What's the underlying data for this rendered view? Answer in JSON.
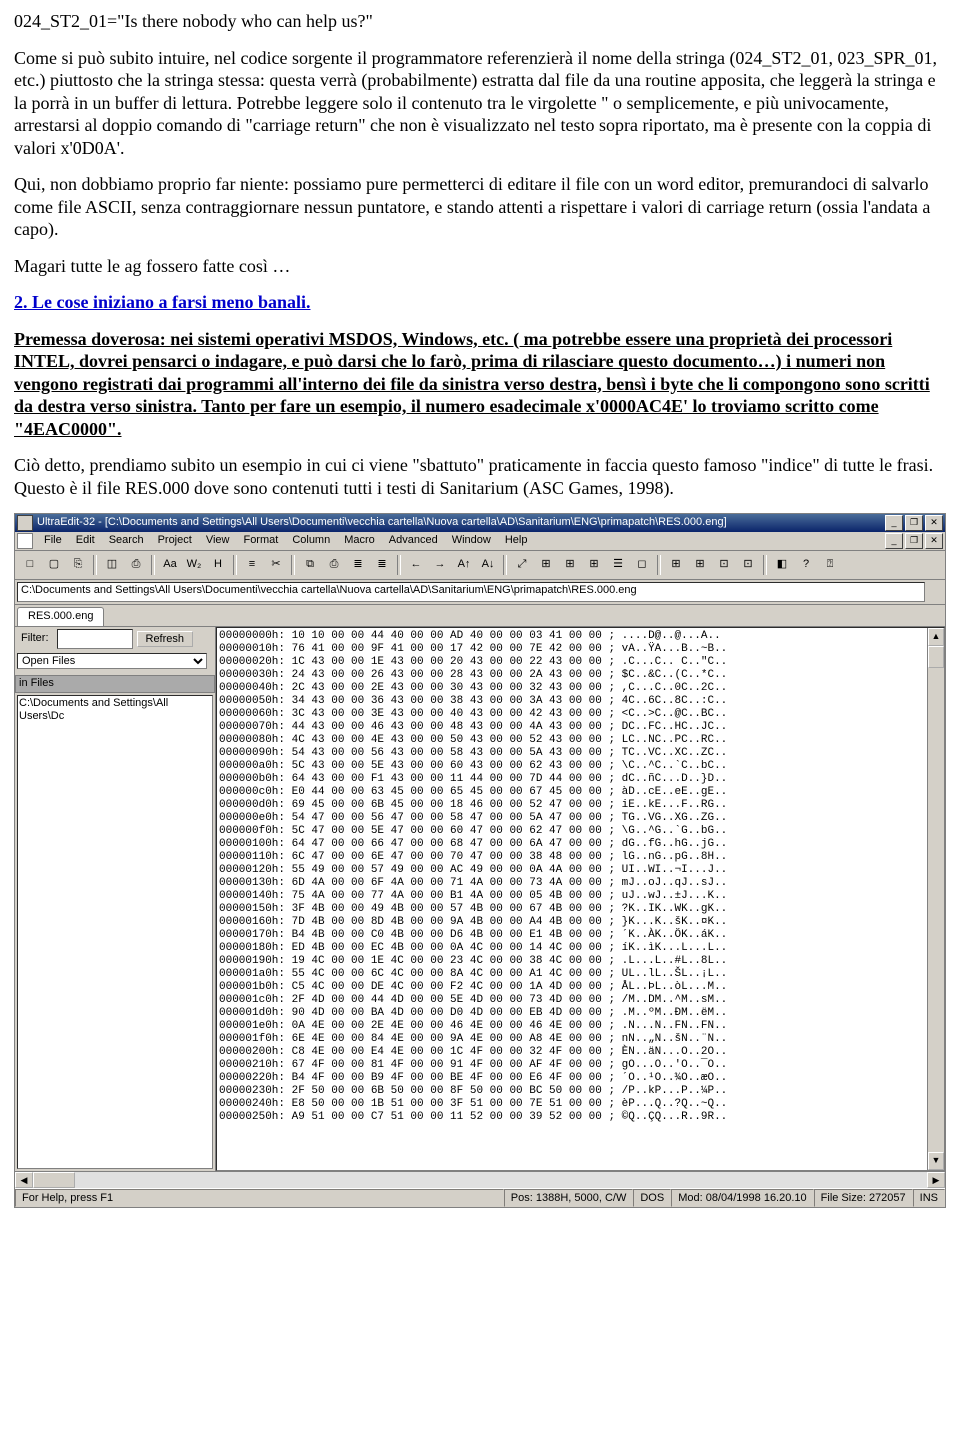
{
  "doc": {
    "p1": "024_ST2_01=\"Is there nobody who can help us?\"",
    "p2": "Come si può subito intuire, nel codice sorgente il programmatore referenzierà il nome della stringa (024_ST2_01, 023_SPR_01, etc.) piuttosto che la stringa stessa: questa verrà (probabilmente) estratta dal file da una routine apposita, che leggerà la stringa e la porrà in un buffer di lettura. Potrebbe leggere solo il contenuto tra le virgolette \" o semplicemente, e più univocamente, arrestarsi al doppio comando di \"carriage return\" che non è visualizzato nel testo sopra riportato, ma è presente con la coppia di valori x'0D0A'.",
    "p3": "Qui, non dobbiamo proprio far niente: possiamo pure permetterci di  editare il file con un word editor, premurandoci di salvarlo come file ASCII, senza contraggiornare nessun puntatore, e stando attenti a rispettare i valori di carriage return (ossia l'andata a capo).",
    "p4": "Magari tutte le ag fossero fatte così …",
    "section_link": "2. Le cose iniziano a farsi meno banali.",
    "p5": "Premessa doverosa: nei sistemi operativi MSDOS, Windows, etc. ( ma potrebbe essere una proprietà dei processori INTEL, dovrei pensarci o indagare, e può darsi che lo farò, prima di rilasciare questo documento…) i numeri non vengono registrati dai programmi all'interno dei file da sinistra verso destra, bensì i byte che li compongono sono scritti da destra verso sinistra. Tanto per fare un esempio, il numero esadecimale x'0000AC4E' lo troviamo scritto come \"4EAC0000\".",
    "p6": "Ciò detto, prendiamo subito un esempio in cui ci viene \"sbattuto\" praticamente in faccia questo famoso \"indice\" di tutte le frasi.",
    "p7": "Questo è il file RES.000 dove sono contenuti tutti i testi di Sanitarium (ASC Games, 1998)."
  },
  "editor": {
    "title": "UltraEdit-32 - [C:\\Documents and Settings\\All Users\\Documenti\\vecchia cartella\\Nuova cartella\\AD\\Sanitarium\\ENG\\primapatch\\RES.000.eng]",
    "menus": [
      "File",
      "Edit",
      "Search",
      "Project",
      "View",
      "Format",
      "Column",
      "Macro",
      "Advanced",
      "Window",
      "Help"
    ],
    "toolbar_items": [
      "□",
      "▢",
      "⎘",
      "◫",
      "⎙",
      "Aa",
      "W₂",
      "H",
      "≡",
      "✂",
      "⧉",
      "⎙",
      "≣",
      "≣",
      "←",
      "→",
      "A↑",
      "A↓",
      "⤢",
      "⊞",
      "⊞",
      "⊞",
      "☰",
      "◻",
      "⊞",
      "⊞",
      "⊡",
      "⊡",
      "◧",
      "?",
      "⍰"
    ],
    "path": "C:\\Documents and Settings\\All Users\\Documenti\\vecchia cartella\\Nuova cartella\\AD\\Sanitarium\\ENG\\primapatch\\RES.000.eng",
    "tab": "RES.000.eng",
    "side": {
      "filter_label": "Filter:",
      "refresh": "Refresh",
      "dropdown": "Open Files",
      "infiles": "in Files",
      "tree1": "C:\\Documents and Settings\\All Users\\Dc"
    },
    "status": {
      "help": "For Help, press F1",
      "pos": "Pos: 1388H, 5000, C/W",
      "dos": "DOS",
      "mod": "Mod: 08/04/1998 16.20.10",
      "size": "File Size: 272057",
      "ins": "INS"
    },
    "hex": [
      "00000000h: 10 10 00 00 44 40 00 00 AD 40 00 00 03 41 00 00 ; ....D@..­@...A..",
      "00000010h: 76 41 00 00 9F 41 00 00 17 42 00 00 7E 42 00 00 ; vA..ŸA...B..~B..",
      "00000020h: 1C 43 00 00 1E 43 00 00 20 43 00 00 22 43 00 00 ; .C...C.. C..\"C..",
      "00000030h: 24 43 00 00 26 43 00 00 28 43 00 00 2A 43 00 00 ; $C..&C..(C..*C..",
      "00000040h: 2C 43 00 00 2E 43 00 00 30 43 00 00 32 43 00 00 ; ,C...C..0C..2C..",
      "00000050h: 34 43 00 00 36 43 00 00 38 43 00 00 3A 43 00 00 ; 4C..6C..8C..:C..",
      "00000060h: 3C 43 00 00 3E 43 00 00 40 43 00 00 42 43 00 00 ; <C..>C..@C..BC..",
      "00000070h: 44 43 00 00 46 43 00 00 48 43 00 00 4A 43 00 00 ; DC..FC..HC..JC..",
      "00000080h: 4C 43 00 00 4E 43 00 00 50 43 00 00 52 43 00 00 ; LC..NC..PC..RC..",
      "00000090h: 54 43 00 00 56 43 00 00 58 43 00 00 5A 43 00 00 ; TC..VC..XC..ZC..",
      "000000a0h: 5C 43 00 00 5E 43 00 00 60 43 00 00 62 43 00 00 ; \\C..^C..`C..bC..",
      "000000b0h: 64 43 00 00 F1 43 00 00 11 44 00 00 7D 44 00 00 ; dC..ñC...D..}D..",
      "000000c0h: E0 44 00 00 63 45 00 00 65 45 00 00 67 45 00 00 ; àD..cE..eE..gE..",
      "000000d0h: 69 45 00 00 6B 45 00 00 18 46 00 00 52 47 00 00 ; iE..kE...F..RG..",
      "000000e0h: 54 47 00 00 56 47 00 00 58 47 00 00 5A 47 00 00 ; TG..VG..XG..ZG..",
      "000000f0h: 5C 47 00 00 5E 47 00 00 60 47 00 00 62 47 00 00 ; \\G..^G..`G..bG..",
      "00000100h: 64 47 00 00 66 47 00 00 68 47 00 00 6A 47 00 00 ; dG..fG..hG..jG..",
      "00000110h: 6C 47 00 00 6E 47 00 00 70 47 00 00 38 48 00 00 ; lG..nG..pG..8H..",
      "00000120h: 55 49 00 00 57 49 00 00 AC 49 00 00 0A 4A 00 00 ; UI..WI..¬I...J..",
      "00000130h: 6D 4A 00 00 6F 4A 00 00 71 4A 00 00 73 4A 00 00 ; mJ..oJ..qJ..sJ..",
      "00000140h: 75 4A 00 00 77 4A 00 00 B1 4A 00 00 05 4B 00 00 ; uJ..wJ..±J...K..",
      "00000150h: 3F 4B 00 00 49 4B 00 00 57 4B 00 00 67 4B 00 00 ; ?K..IK..WK..gK..",
      "00000160h: 7D 4B 00 00 8D 4B 00 00 9A 4B 00 00 A4 4B 00 00 ; }K...K..šK..¤K..",
      "00000170h: B4 4B 00 00 C0 4B 00 00 D6 4B 00 00 E1 4B 00 00 ; ´K..ÀK..ÖK..áK..",
      "00000180h: ED 4B 00 00 EC 4B 00 00 0A 4C 00 00 14 4C 00 00 ; íK..ìK...L...L..",
      "00000190h: 19 4C 00 00 1E 4C 00 00 23 4C 00 00 38 4C 00 00 ; .L...L..#L..8L..",
      "000001a0h: 55 4C 00 00 6C 4C 00 00 8A 4C 00 00 A1 4C 00 00 ; UL..lL..ŠL..¡L..",
      "000001b0h: C5 4C 00 00 DE 4C 00 00 F2 4C 00 00 1A 4D 00 00 ; ÅL..ÞL..òL...M..",
      "000001c0h: 2F 4D 00 00 44 4D 00 00 5E 4D 00 00 73 4D 00 00 ; /M..DM..^M..sM..",
      "000001d0h: 90 4D 00 00 BA 4D 00 00 D0 4D 00 00 EB 4D 00 00 ; .M..ºM..ÐM..ëM..",
      "000001e0h: 0A 4E 00 00 2E 4E 00 00 46 4E 00 00 46 4E 00 00 ; .N...N..FN..FN..",
      "000001f0h: 6E 4E 00 00 84 4E 00 00 9A 4E 00 00 A8 4E 00 00 ; nN..„N..šN..¨N..",
      "00000200h: C8 4E 00 00 E4 4E 00 00 1C 4F 00 00 32 4F 00 00 ; ÈN..äN...O..2O..",
      "00000210h: 67 4F 00 00 81 4F 00 00 91 4F 00 00 AF 4F 00 00 ; gO...O..'O..¯O..",
      "00000220h: B4 4F 00 00 B9 4F 00 00 BE 4F 00 00 E6 4F 00 00 ; ´O..¹O..¾O..æO..",
      "00000230h: 2F 50 00 00 6B 50 00 00 8F 50 00 00 BC 50 00 00 ; /P..kP...P..¼P..",
      "00000240h: E8 50 00 00 1B 51 00 00 3F 51 00 00 7E 51 00 00 ; èP...Q..?Q..~Q..",
      "00000250h: A9 51 00 00 C7 51 00 00 11 52 00 00 39 52 00 00 ; ©Q..ÇQ...R..9R.."
    ]
  }
}
